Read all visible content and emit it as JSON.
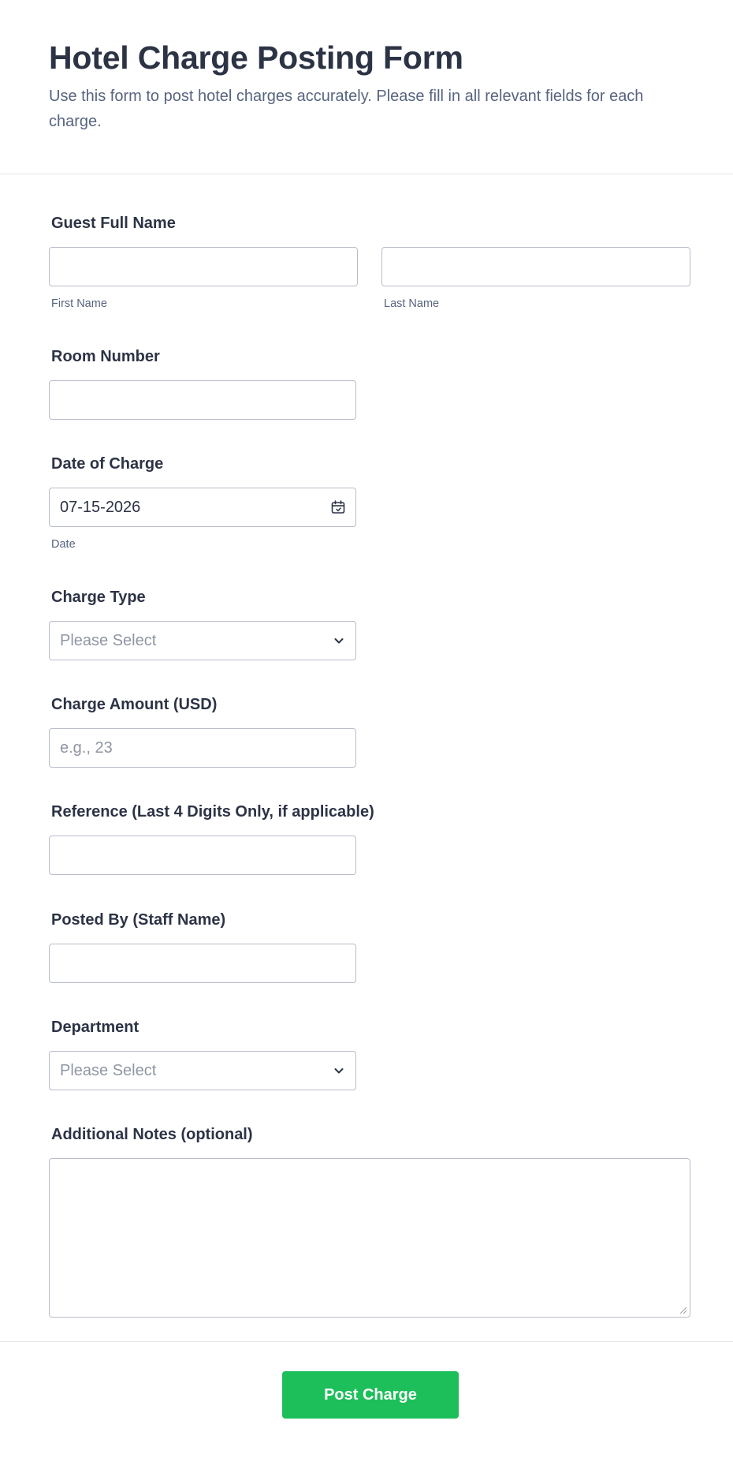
{
  "form": {
    "title": "Hotel Charge Posting Form",
    "subtitle": "Use this form to post hotel charges accurately. Please fill in all relevant fields for each charge."
  },
  "guest_name": {
    "label": "Guest Full Name",
    "first_value": "",
    "first_sublabel": "First Name",
    "last_value": "",
    "last_sublabel": "Last Name"
  },
  "room_number": {
    "label": "Room Number",
    "value": ""
  },
  "date_of_charge": {
    "label": "Date of Charge",
    "value": "07-15-2026",
    "sublabel": "Date",
    "icon": "calendar-icon"
  },
  "charge_type": {
    "label": "Charge Type",
    "placeholder": "Please Select",
    "icon": "chevron-down-icon"
  },
  "charge_amount": {
    "label": "Charge Amount (USD)",
    "placeholder": "e.g., 23"
  },
  "reference": {
    "label": "Reference (Last 4 Digits Only, if applicable)",
    "value": ""
  },
  "posted_by": {
    "label": "Posted By (Staff Name)",
    "value": ""
  },
  "department": {
    "label": "Department",
    "placeholder": "Please Select",
    "icon": "chevron-down-icon"
  },
  "notes": {
    "label": "Additional Notes (optional)",
    "value": ""
  },
  "submit": {
    "label": "Post Charge"
  },
  "colors": {
    "accent": "#1dbf5b",
    "text": "#2c3345",
    "muted": "#57647e",
    "border": "#b8bdc9"
  }
}
